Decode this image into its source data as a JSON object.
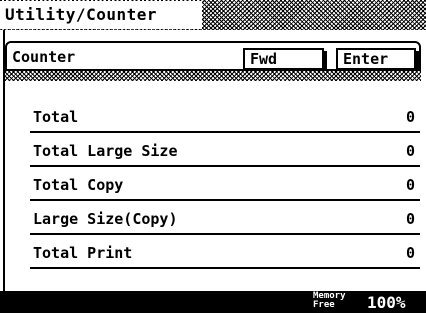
{
  "title": "Utility/Counter",
  "header": {
    "label": "Counter",
    "fwd_label": "Fwd",
    "enter_label": "Enter"
  },
  "rows": [
    {
      "label": "Total",
      "value": "0"
    },
    {
      "label": "Total Large Size",
      "value": "0"
    },
    {
      "label": "Total Copy",
      "value": "0"
    },
    {
      "label": "Large Size(Copy)",
      "value": "0"
    },
    {
      "label": "Total Print",
      "value": "0"
    }
  ],
  "status": {
    "memory_label_line1": "Memory",
    "memory_label_line2": "Free",
    "memory_value": "100%"
  }
}
